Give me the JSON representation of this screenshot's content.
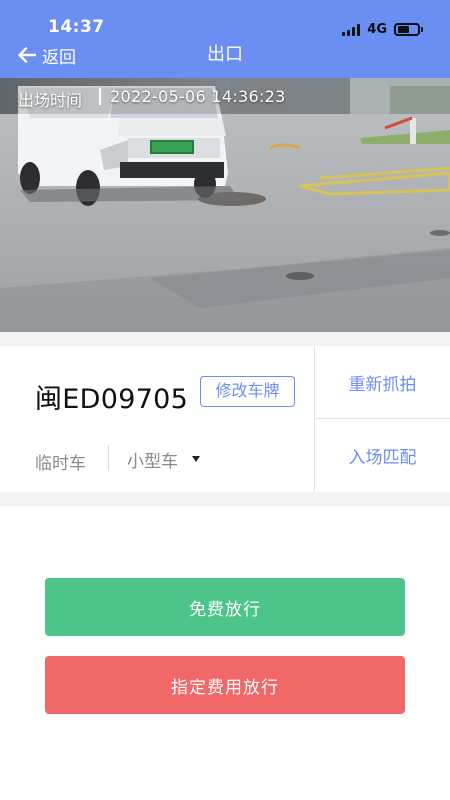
{
  "status_bar": {
    "time": "14:37",
    "network": "4G",
    "battery_level": 0.6
  },
  "nav": {
    "back_label": "返回",
    "title": "出口",
    "back_icon": "arrow-left-icon"
  },
  "camera": {
    "entry_label": "出场时间",
    "entry_time": "2022-05-06 14:36:23"
  },
  "vehicle": {
    "plate": "闽ED09705",
    "edit_plate_label": "修改车牌",
    "kind": "临时车",
    "size": "小型车",
    "size_icon": "caret-down-icon"
  },
  "side_actions": {
    "recapture": "重新抓拍",
    "entry_match": "入场匹配"
  },
  "actions": {
    "free_release": "免费放行",
    "paid_release": "指定费用放行"
  },
  "colors": {
    "primary": "#6b8ef2",
    "success": "#4dc48a",
    "danger": "#f06868"
  }
}
